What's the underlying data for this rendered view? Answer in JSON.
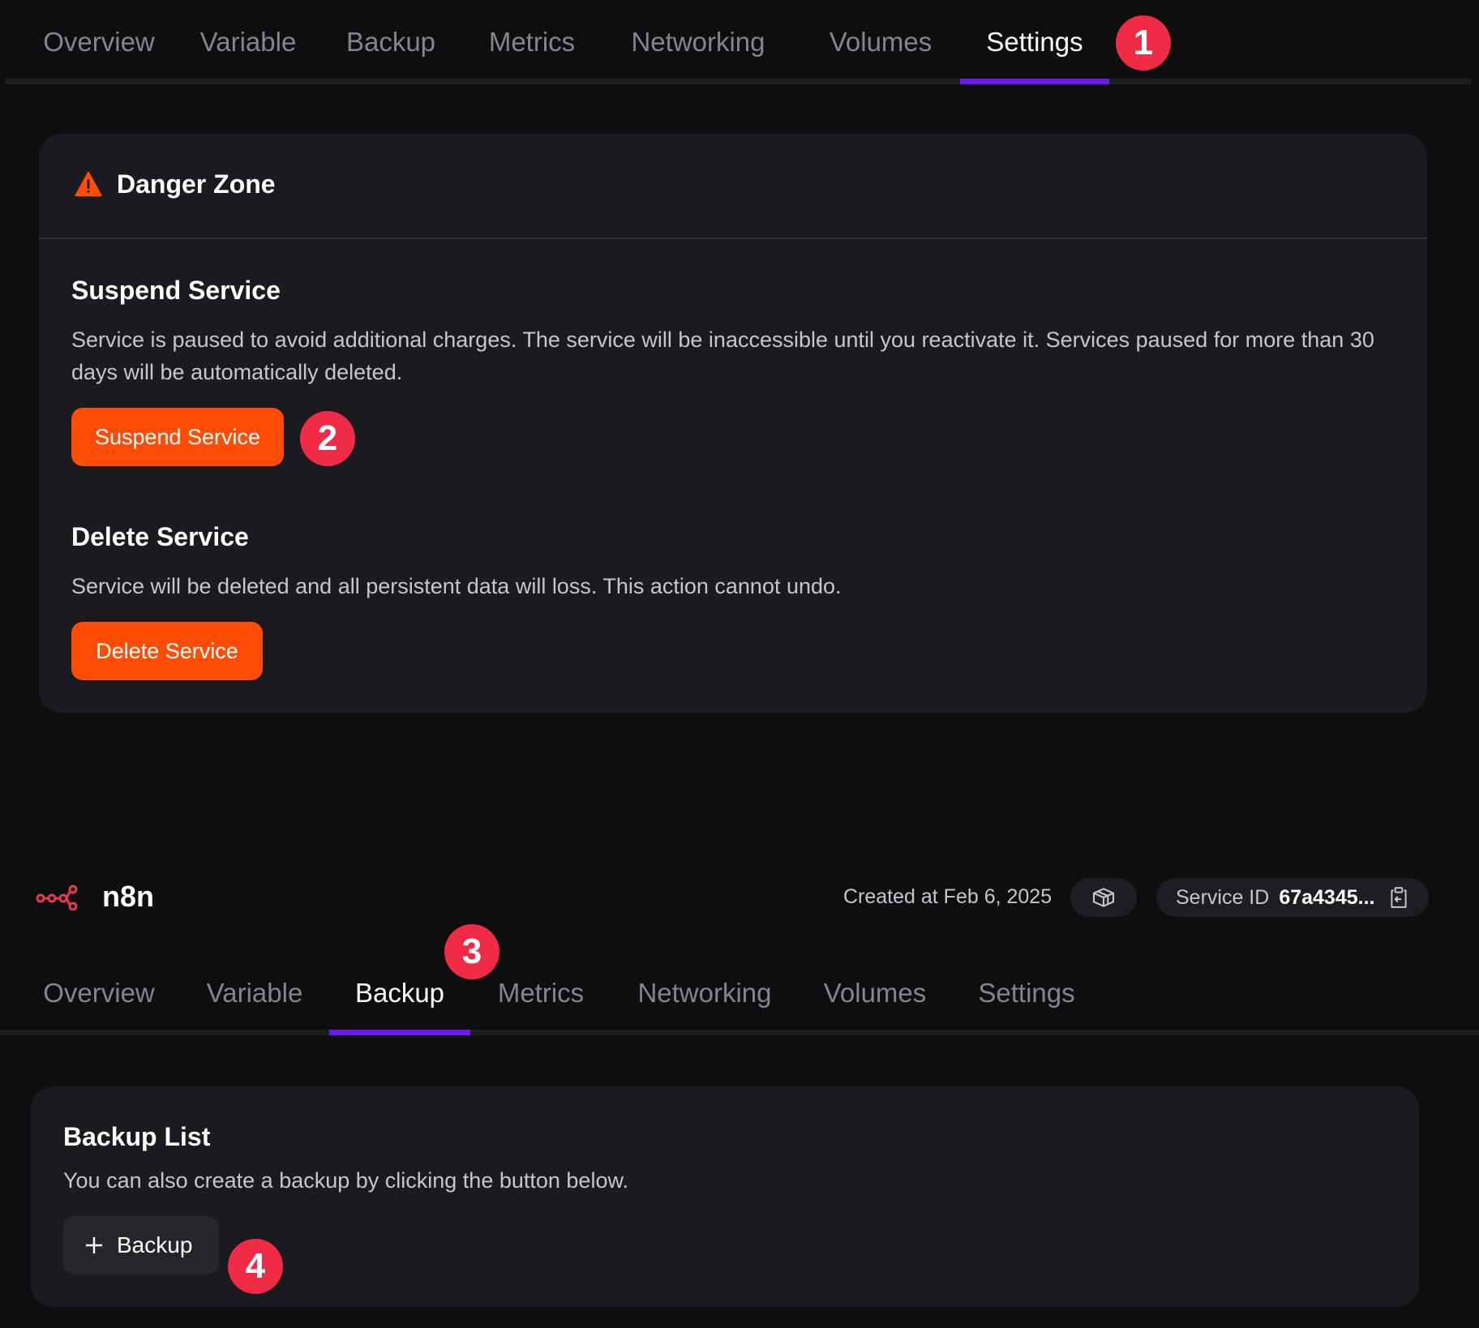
{
  "top_tabs": [
    "Overview",
    "Variable",
    "Backup",
    "Metrics",
    "Networking",
    "Volumes",
    "Settings"
  ],
  "top_active": "Settings",
  "danger": {
    "title": "Danger Zone",
    "suspend": {
      "heading": "Suspend Service",
      "text": "Service is paused to avoid additional charges. The service will be inaccessible until you reactivate it. Services paused for more than 30 days will be automatically deleted.",
      "button": "Suspend Service"
    },
    "delete": {
      "heading": "Delete Service",
      "text": "Service will be deleted and all persistent data will loss. This action cannot undo.",
      "button": "Delete Service"
    }
  },
  "service": {
    "name": "n8n",
    "created": "Created at Feb 6, 2025",
    "id_label": "Service ID",
    "id_value": "67a4345..."
  },
  "bottom_tabs": [
    "Overview",
    "Variable",
    "Backup",
    "Metrics",
    "Networking",
    "Volumes",
    "Settings"
  ],
  "bottom_active": "Backup",
  "backup": {
    "title": "Backup List",
    "text": "You can also create a backup by clicking the button below.",
    "button": "Backup"
  },
  "markers": [
    "1",
    "2",
    "3",
    "4"
  ],
  "colors": {
    "accent": "#6a1be8",
    "danger": "#ff4d08",
    "marker": "#ef2b45",
    "warning_icon": "#ff4d08",
    "logo": "#e23c4f"
  },
  "icons": [
    "warning-icon",
    "n8n-logo-icon",
    "cube-icon",
    "copy-icon",
    "plus-icon"
  ]
}
